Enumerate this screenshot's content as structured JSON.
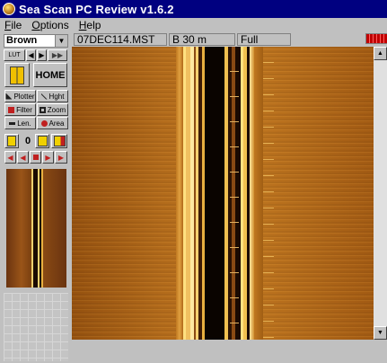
{
  "window": {
    "title": "Sea Scan PC Review v1.6.2"
  },
  "menu": {
    "items": [
      {
        "accel": "F",
        "rest": "ile"
      },
      {
        "accel": "O",
        "rest": "ptions"
      },
      {
        "accel": "H",
        "rest": "elp"
      }
    ]
  },
  "left_panel": {
    "color_scheme": "Brown",
    "home_label": "HOME",
    "tools": {
      "plotter": "Plotter",
      "height": "Hght",
      "filter": "Filter",
      "zoom": "Zoom",
      "length": "Len.",
      "area": "Area"
    },
    "marker_count": "0",
    "lut_label": "LUT"
  },
  "info_bar": {
    "filename": "07DEC114.MST",
    "range": "B 30 m",
    "mode": "Full"
  },
  "colors": {
    "titlebar": "#000080",
    "sonar_bg": "#b06818",
    "palette_red": "#c00000"
  }
}
